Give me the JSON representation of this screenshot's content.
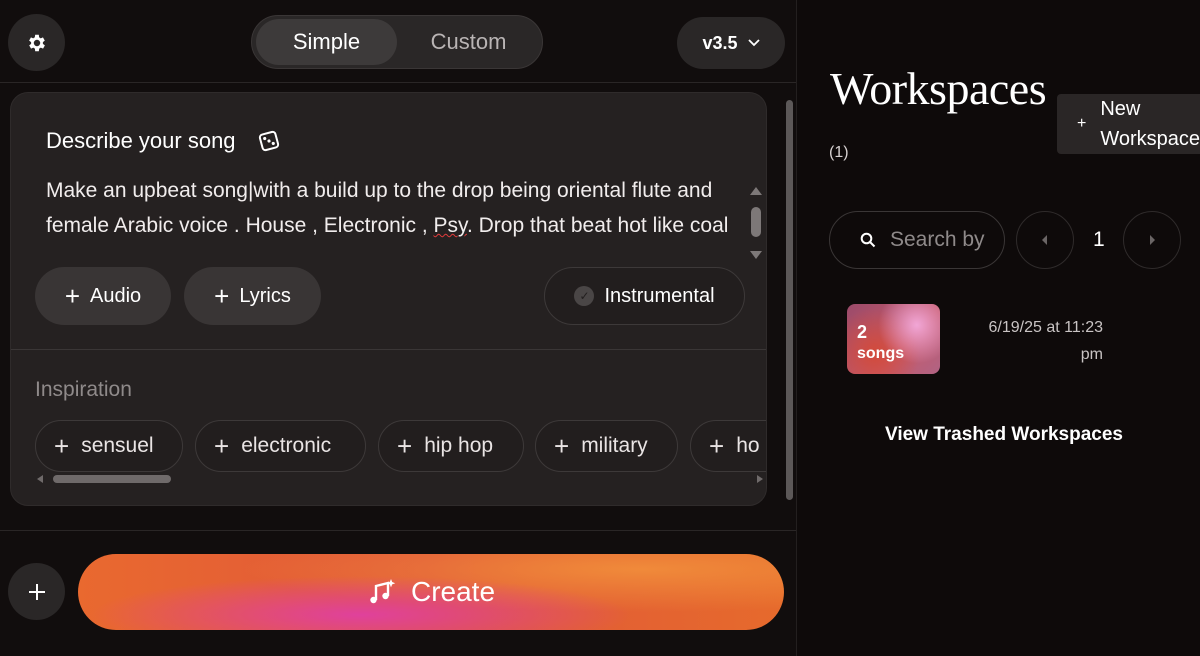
{
  "header": {
    "mode_simple": "Simple",
    "mode_custom": "Custom",
    "version": "v3.5"
  },
  "composer": {
    "title": "Describe your song",
    "prompt_before": "Make an upbeat song|with a build up to the drop being  oriental flute and female  Arabic voice . House , Electronic , ",
    "prompt_misspelled": "Psy",
    "prompt_after": ". Drop that beat hot like coal",
    "audio_label": "Audio",
    "lyrics_label": "Lyrics",
    "instrumental_label": "Instrumental",
    "inspiration_label": "Inspiration",
    "tags": [
      "sensuel",
      "electronic",
      "hip hop",
      "military",
      "ho"
    ]
  },
  "create": {
    "label": "Create"
  },
  "workspaces": {
    "title": "Workspaces",
    "count": "(1)",
    "new_label": "New\nWorkspace",
    "search_placeholder": "Search by",
    "page": "1",
    "item": {
      "count_num": "2",
      "count_unit": "songs",
      "date": "6/19/25 at 11:23 pm"
    },
    "view_trashed": "View Trashed Workspaces"
  },
  "colors": {
    "accent_orange": "#e9692f",
    "accent_pink": "#e0419c",
    "bg": "#0e0a0a",
    "card": "#252121"
  }
}
